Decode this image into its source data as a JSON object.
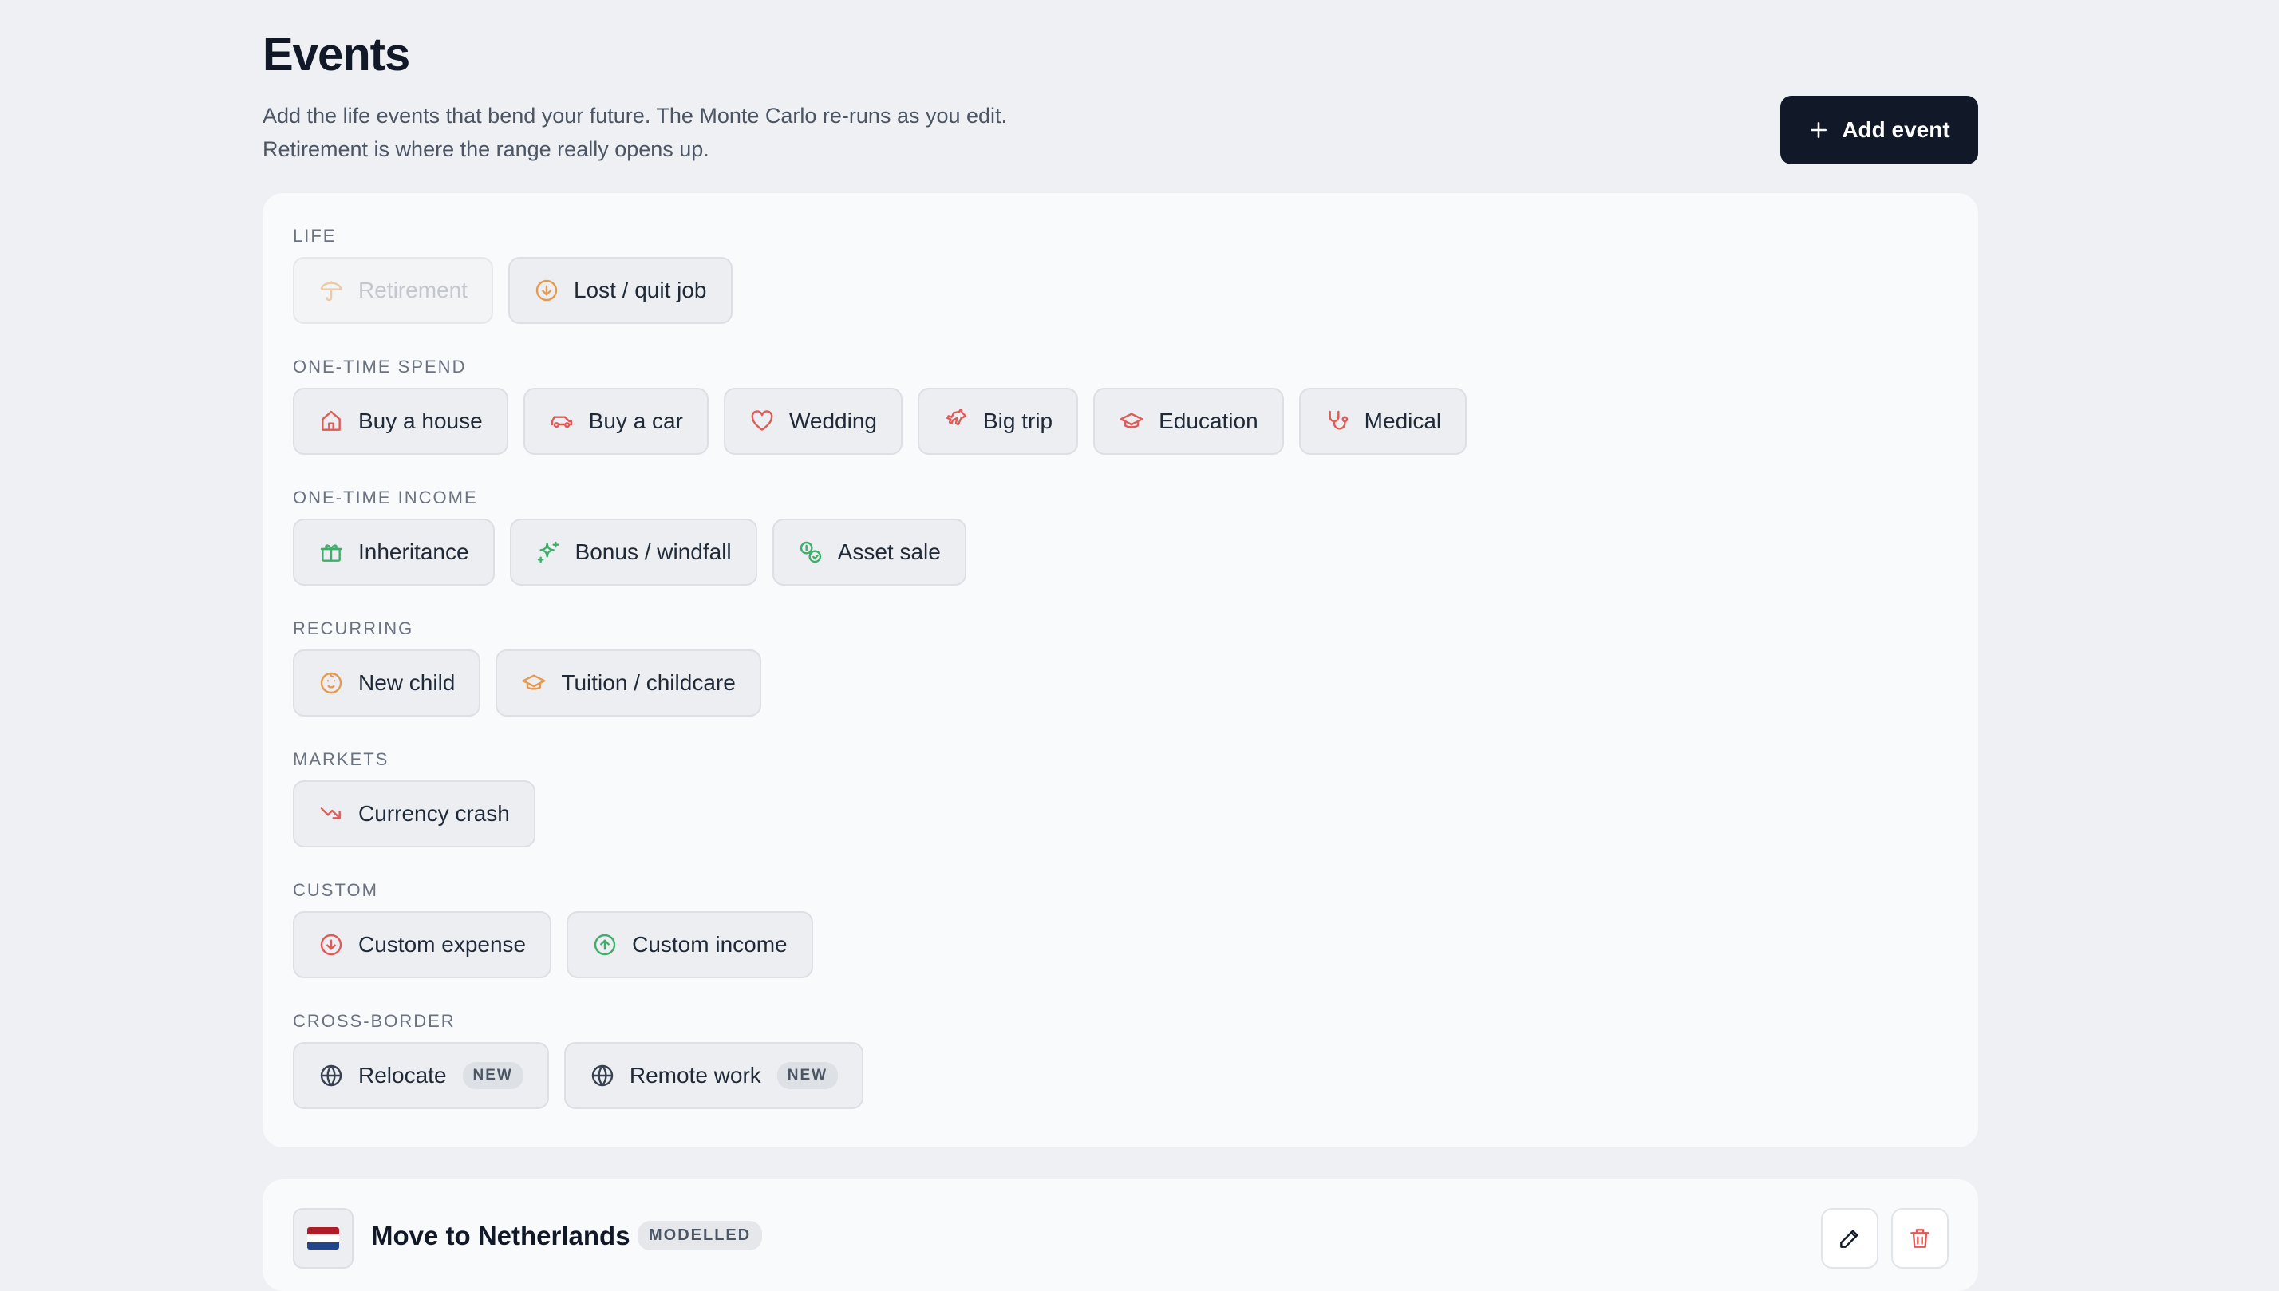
{
  "header": {
    "title": "Events",
    "subtitle_line1": "Add the life events that bend your future. The Monte Carlo re-runs as you edit.",
    "subtitle_line2": "Retirement is where the range really opens up.",
    "add_button_label": "Add event"
  },
  "groups": [
    {
      "label": "LIFE",
      "items": [
        {
          "label": "Retirement",
          "icon": "umbrella-icon",
          "disabled": true
        },
        {
          "label": "Lost / quit job",
          "icon": "arrow-down-circle-icon"
        }
      ]
    },
    {
      "label": "ONE-TIME SPEND",
      "items": [
        {
          "label": "Buy a house",
          "icon": "house-icon"
        },
        {
          "label": "Buy a car",
          "icon": "car-icon"
        },
        {
          "label": "Wedding",
          "icon": "heart-icon"
        },
        {
          "label": "Big trip",
          "icon": "plane-icon"
        },
        {
          "label": "Education",
          "icon": "graduation-cap-icon"
        },
        {
          "label": "Medical",
          "icon": "stethoscope-icon"
        }
      ]
    },
    {
      "label": "ONE-TIME INCOME",
      "items": [
        {
          "label": "Inheritance",
          "icon": "gift-icon"
        },
        {
          "label": "Bonus / windfall",
          "icon": "sparkles-icon"
        },
        {
          "label": "Asset sale",
          "icon": "coins-icon"
        }
      ]
    },
    {
      "label": "RECURRING",
      "items": [
        {
          "label": "New child",
          "icon": "baby-icon"
        },
        {
          "label": "Tuition / childcare",
          "icon": "graduation-cap-icon"
        }
      ]
    },
    {
      "label": "MARKETS",
      "items": [
        {
          "label": "Currency crash",
          "icon": "trending-down-icon"
        }
      ]
    },
    {
      "label": "CUSTOM",
      "items": [
        {
          "label": "Custom expense",
          "icon": "arrow-down-circle-icon"
        },
        {
          "label": "Custom income",
          "icon": "arrow-up-circle-icon"
        }
      ]
    },
    {
      "label": "CROSS-BORDER",
      "items": [
        {
          "label": "Relocate",
          "icon": "globe-icon",
          "badge": "NEW"
        },
        {
          "label": "Remote work",
          "icon": "globe-icon",
          "badge": "NEW"
        }
      ]
    }
  ],
  "event": {
    "title": "Move to Netherlands",
    "status_badge": "MODELLED",
    "flag_icon": "netherlands-flag-icon",
    "flag_colors": [
      "#ae1c28",
      "#ffffff",
      "#21468b"
    ]
  },
  "colors": {
    "primary_button": "#111827",
    "spend_icon": "#e05a57",
    "income_icon": "#3fae6a",
    "recurring_icon": "#e79a4f",
    "neutral_icon": "#374151",
    "delete_icon": "#e05a57"
  }
}
